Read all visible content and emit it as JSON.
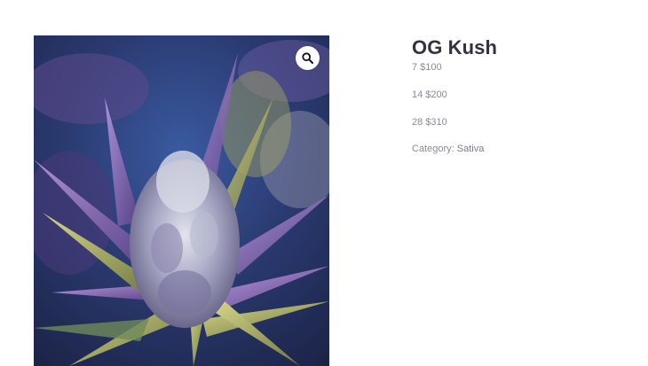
{
  "product": {
    "title": "OG Kush",
    "prices": [
      {
        "label": "7 $100"
      },
      {
        "label": "14 $200"
      },
      {
        "label": "28 $310"
      }
    ],
    "category_label": "Category:",
    "category_value": "Sativa"
  },
  "gallery": {
    "zoom_icon": "magnifier-icon"
  },
  "colors": {
    "title": "#333340",
    "meta_text": "#8a8a9a",
    "photo_background": "#2b3a6e",
    "leaf_purple": "#7a5a9e",
    "leaf_green": "#9aa05a",
    "bud_frost": "#c9cdd8"
  }
}
